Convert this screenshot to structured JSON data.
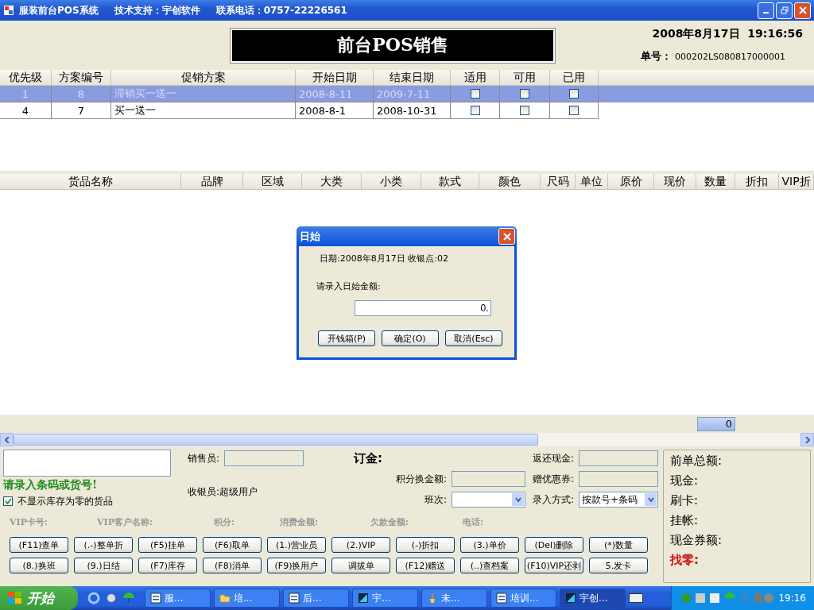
{
  "window": {
    "title": "服装前台POS系统",
    "support": "技术支持：宇创软件",
    "phone": "联系电话：0757-22226561"
  },
  "header": {
    "banner": "前台POS销售",
    "datetime": "2008年8月17日  19:16:56",
    "order_label": "单号：",
    "order_no": "000202LS080817000001"
  },
  "promo_table": {
    "columns": [
      "优先级",
      "方案编号",
      "促销方案",
      "开始日期",
      "结束日期",
      "适用",
      "可用",
      "已用"
    ],
    "rows": [
      {
        "priority": "1",
        "plan_no": "8",
        "plan": "滞销买一送一",
        "start": "2008-8-11",
        "end": "2009-7-11",
        "applicable": false,
        "available": false,
        "used": false,
        "selected": true
      },
      {
        "priority": "4",
        "plan_no": "7",
        "plan": "买一送一",
        "start": "2008-8-1",
        "end": "2008-10-31",
        "applicable": false,
        "available": false,
        "used": false,
        "selected": false
      }
    ]
  },
  "goods_table": {
    "columns": [
      "货品名称",
      "品牌",
      "区域",
      "大类",
      "小类",
      "款式",
      "颜色",
      "尺码",
      "单位",
      "原价",
      "现价",
      "数量",
      "折扣",
      "VIP折"
    ],
    "total_quantity": "0"
  },
  "dialog": {
    "title": "日始",
    "info": "日期:2008年8月17日 收银点:02",
    "prompt": "请录入日始金额:",
    "value": "0.",
    "buttons": [
      "开钱箱(P)",
      "确定(O)",
      "取消(Esc)"
    ]
  },
  "entry": {
    "prompt": "请录入条码或货号!",
    "hide_zero_stock": {
      "label": "不显示库存为零的货品",
      "checked": true
    },
    "salesperson_label": "销售员:",
    "cashier": "收银员:超级用户",
    "deposit_label": "订金:",
    "points_label": "积分换金额:",
    "shift_label": "班次:",
    "return_cash_label": "返还现金:",
    "coupon_label": "赠优惠券:",
    "input_mode_label": "录入方式:",
    "input_mode": "按款号+条码"
  },
  "vip_labels": [
    "VIP卡号:",
    "VIP客户名称:",
    "积分:",
    "消费金额:",
    "欠款金额:",
    "电话:"
  ],
  "buttons": [
    "(F11)查单",
    "(.-)整单折",
    "(F5)挂单",
    "(F6)取单",
    "(1.)营业员",
    "(2.)VIP",
    "(-)折扣",
    "(3.)单价",
    "(Del)删除",
    "(*)数量",
    "(8.)换班",
    "(9.)日结",
    "(F7)库存",
    "(F8)消单",
    "(F9)换用户",
    "调拔单",
    "(F12)赠送",
    "(..)查档案",
    "(F10)VIP还剥",
    "5.发卡"
  ],
  "totals": [
    {
      "label": "前单总额:",
      "kind": "normal"
    },
    {
      "label": "现金:",
      "kind": "normal"
    },
    {
      "label": "刷卡:",
      "kind": "normal"
    },
    {
      "label": "挂帐:",
      "kind": "normal"
    },
    {
      "label": "现金券额:",
      "kind": "normal"
    },
    {
      "label": "找零:",
      "kind": "change"
    }
  ],
  "taskbar": {
    "start": "开始",
    "tasks": [
      {
        "label": "服...",
        "kind": "doc",
        "selected": false
      },
      {
        "label": "培...",
        "kind": "folder",
        "selected": false
      },
      {
        "label": "后...",
        "kind": "doc",
        "selected": false
      },
      {
        "label": "宇...",
        "kind": "app",
        "selected": false
      },
      {
        "label": "未...",
        "kind": "paint",
        "selected": false
      },
      {
        "label": "培训...",
        "kind": "doc",
        "selected": false
      },
      {
        "label": "宇创...",
        "kind": "app",
        "selected": true
      }
    ],
    "clock": "19:16"
  }
}
